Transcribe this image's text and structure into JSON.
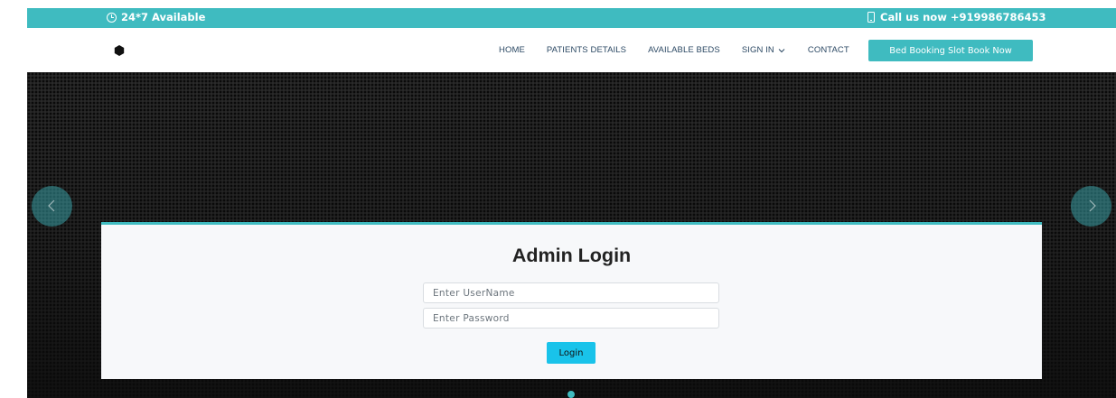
{
  "topbar": {
    "availability": "24*7 Available",
    "call": "Call us now +919986786453",
    "icons": {
      "availability": "clock-icon",
      "call": "phone-icon"
    },
    "color": "#3fbbc0"
  },
  "nav": {
    "items": [
      "HOME",
      "PATIENTS DETAILS",
      "AVAILABLE BEDS",
      "SIGN IN",
      "CONTACT"
    ],
    "cta": "Bed Booking Slot Book Now"
  },
  "hero": {
    "controls": {
      "prev": "chevron-left-icon",
      "next": "chevron-right-icon"
    }
  },
  "login": {
    "title": "Admin Login",
    "username_placeholder": "Enter UserName",
    "password_placeholder": "Enter Password",
    "button": "Login"
  },
  "colors": {
    "accent": "#3fbbc0",
    "login_button": "#19c3ea",
    "text": "#2c4964"
  }
}
